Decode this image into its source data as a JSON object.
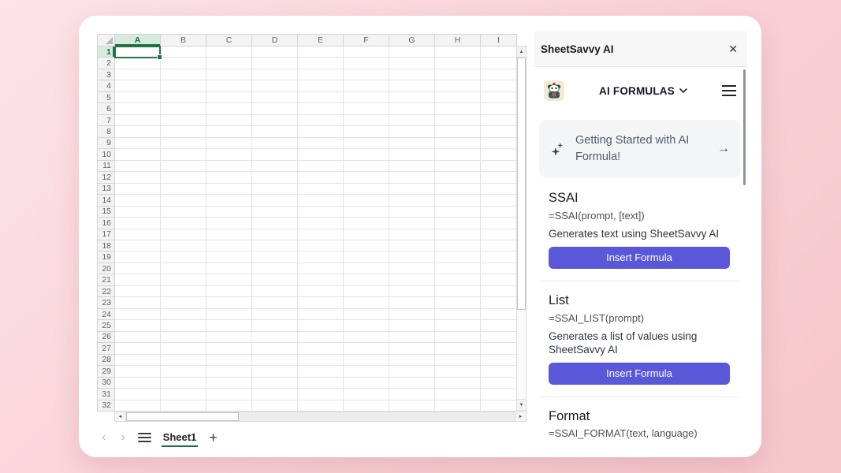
{
  "spreadsheet": {
    "columns": [
      "A",
      "B",
      "C",
      "D",
      "E",
      "F",
      "G",
      "H",
      "I"
    ],
    "row_count": 32,
    "selected_column": "A",
    "selected_row": 1,
    "selection_color": "#217346",
    "sheet_tab": "Sheet1"
  },
  "panel": {
    "title": "SheetSavvy AI",
    "nav": {
      "dropdown_label": "AI FORMULAS",
      "logo": "sheetsavvy-mascot"
    },
    "banner": {
      "text": "Getting Started with AI Formula!"
    },
    "sections": [
      {
        "name": "SSAI",
        "formula": "=SSAI(prompt, [text])",
        "description": "Generates text using SheetSavvy AI",
        "button": "Insert Formula"
      },
      {
        "name": "List",
        "formula": "=SSAI_LIST(prompt)",
        "description": "Generates a list of values using SheetSavvy AI",
        "button": "Insert Formula"
      },
      {
        "name": "Format",
        "formula": "=SSAI_FORMAT(text, language)"
      }
    ],
    "accent_color": "#5a57d9"
  },
  "icons": {
    "close": "✕",
    "arrow_right": "→",
    "sheet_prev": "‹",
    "sheet_next": "›",
    "add_sheet": "+",
    "scroll_up": "▲",
    "scroll_down": "▼",
    "scroll_left": "◄",
    "scroll_right": "►"
  }
}
